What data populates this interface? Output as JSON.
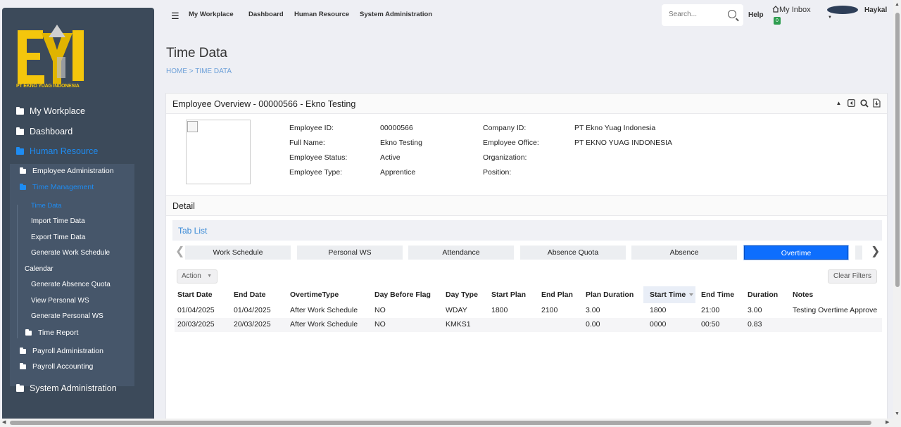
{
  "brand": {
    "name": "PT EKNO YUAG INDONESIA",
    "color": "#f4c60c",
    "accent": "#1e8cf2"
  },
  "sidebar": {
    "items": [
      {
        "label": "My Workplace"
      },
      {
        "label": "Dashboard"
      },
      {
        "label": "Human Resource"
      },
      {
        "label": "System Administration"
      }
    ],
    "hr_items": [
      {
        "label": "Employee Administration"
      },
      {
        "label": "Time Management"
      },
      {
        "label": "Payroll Administration"
      },
      {
        "label": "Payroll Accounting"
      }
    ],
    "tm_items": [
      {
        "label": "Time Data"
      },
      {
        "label": "Import Time Data"
      },
      {
        "label": "Export Time Data"
      },
      {
        "label": "Generate Work Schedule"
      },
      {
        "label": "Calendar"
      },
      {
        "label": "Generate Absence Quota"
      },
      {
        "label": "View Personal WS"
      },
      {
        "label": "Generate Personal WS"
      },
      {
        "label": "Time Report"
      }
    ]
  },
  "topbar": {
    "nav": [
      "My Workplace",
      "Dashboard",
      "Human Resource",
      "System Administration"
    ],
    "search_placeholder": "Search...",
    "help": "Help",
    "inbox": "My Inbox",
    "inbox_count": "0",
    "user": "Haykal"
  },
  "page": {
    "title": "Time Data",
    "breadcrumb": "HOME > TIME DATA"
  },
  "overview": {
    "title": "Employee Overview - 00000566 - Ekno Testing",
    "fields": {
      "employee_id_label": "Employee ID:",
      "employee_id": "00000566",
      "full_name_label": "Full Name:",
      "full_name": "Ekno Testing",
      "status_label": "Employee Status:",
      "status": "Active",
      "type_label": "Employee Type:",
      "type": "Apprentice",
      "company_id_label": "Company ID:",
      "company_id": "PT Ekno Yuag Indonesia",
      "office_label": "Employee Office:",
      "office": "PT EKNO YUAG INDONESIA",
      "org_label": "Organization:",
      "position_label": "Position:"
    }
  },
  "detail": {
    "title": "Detail",
    "tablist_label": "Tab List",
    "tabs": [
      "Work Schedule",
      "Personal WS",
      "Attendance",
      "Absence Quota",
      "Absence",
      "Overtime"
    ],
    "active_tab": "Overtime",
    "action_label": "Action",
    "clear_filters": "Clear Filters"
  },
  "table": {
    "columns": [
      "Start Date",
      "End Date",
      "OvertimeType",
      "Day Before Flag",
      "Day Type",
      "Start Plan",
      "End Plan",
      "Plan Duration",
      "Start Time",
      "End Time",
      "Duration",
      "Notes"
    ],
    "rows": [
      [
        "01/04/2025",
        "01/04/2025",
        "After Work Schedule",
        "NO",
        "WDAY",
        "1800",
        "2100",
        "3.00",
        "1800",
        "21:00",
        "3.00",
        "Testing Overtime Approve"
      ],
      [
        "20/03/2025",
        "20/03/2025",
        "After Work Schedule",
        "NO",
        "KMKS1",
        "",
        "",
        "0.00",
        "0000",
        "00:50",
        "0.83",
        ""
      ]
    ]
  }
}
